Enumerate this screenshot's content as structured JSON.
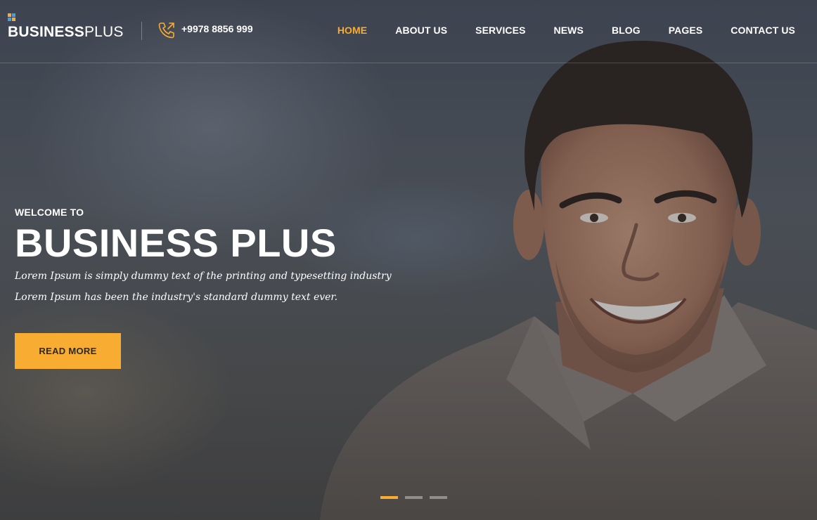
{
  "brand": {
    "name_bold": "BUSINESS",
    "name_light": "PLUS",
    "square_colors": [
      "#f9ac32",
      "#3fa2e0",
      "#3fa2e0",
      "#f9ac32"
    ]
  },
  "contact": {
    "phone": "+9978 8856 999",
    "icon": "phone-icon"
  },
  "nav": {
    "items": [
      {
        "label": "HOME",
        "active": true
      },
      {
        "label": "ABOUT US",
        "active": false
      },
      {
        "label": "SERVICES",
        "active": false
      },
      {
        "label": "NEWS",
        "active": false
      },
      {
        "label": "BLOG",
        "active": false
      },
      {
        "label": "PAGES",
        "active": false
      },
      {
        "label": "CONTACT US",
        "active": false
      }
    ]
  },
  "hero": {
    "welcome": "WELCOME TO",
    "headline": "BUSINESS PLUS",
    "tagline_1": "Lorem Ipsum is simply dummy text of the printing and typesetting industry",
    "tagline_2": "Lorem Ipsum has been the industry's standard dummy text ever.",
    "cta_label": "READ MORE"
  },
  "slider": {
    "slide_count": 3,
    "active_index": 0
  },
  "colors": {
    "accent": "#f9ac32",
    "text": "#ffffff",
    "cta_text": "#2a2a2a"
  }
}
